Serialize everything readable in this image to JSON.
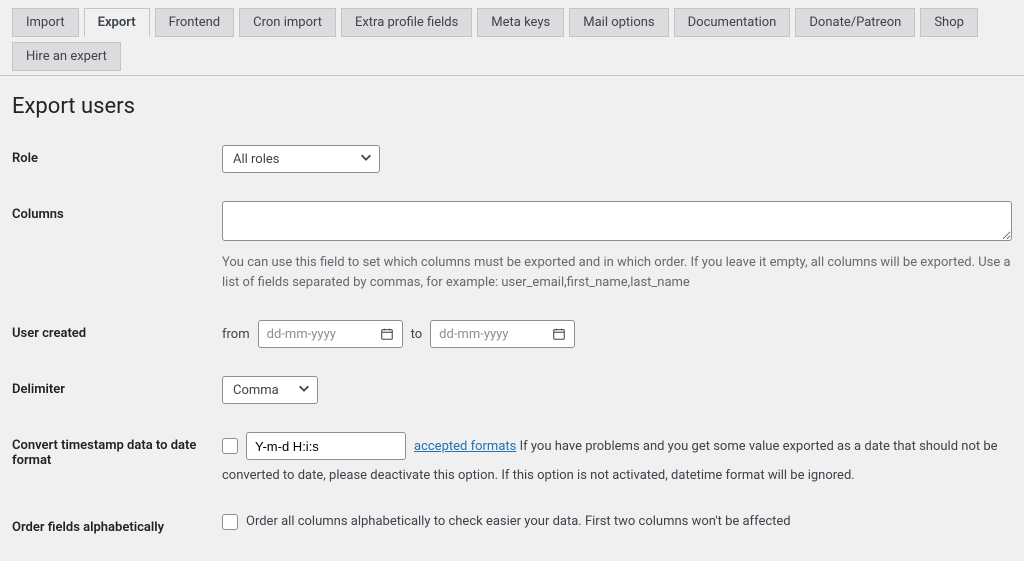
{
  "tabs": {
    "items": [
      {
        "label": "Import",
        "active": false
      },
      {
        "label": "Export",
        "active": true
      },
      {
        "label": "Frontend",
        "active": false
      },
      {
        "label": "Cron import",
        "active": false
      },
      {
        "label": "Extra profile fields",
        "active": false
      },
      {
        "label": "Meta keys",
        "active": false
      },
      {
        "label": "Mail options",
        "active": false
      },
      {
        "label": "Documentation",
        "active": false
      },
      {
        "label": "Donate/Patreon",
        "active": false
      },
      {
        "label": "Shop",
        "active": false
      },
      {
        "label": "Hire an expert",
        "active": false
      }
    ]
  },
  "page": {
    "title": "Export users"
  },
  "form": {
    "role": {
      "label": "Role",
      "selected": "All roles"
    },
    "columns": {
      "label": "Columns",
      "value": "",
      "help": "You can use this field to set which columns must be exported and in which order. If you leave it empty, all columns will be exported. Use a list of fields separated by commas, for example: user_email,first_name,last_name"
    },
    "user_created": {
      "label": "User created",
      "from_label": "from",
      "to_label": "to",
      "placeholder": "dd-mm-yyyy"
    },
    "delimiter": {
      "label": "Delimiter",
      "selected": "Comma"
    },
    "timestamp": {
      "label": "Convert timestamp data to date format",
      "format_value": "Y-m-d H:i:s",
      "link_text": "accepted formats",
      "suffix_inline": " If you have problems and you get some value exported as a date that should not be",
      "suffix_line2": "converted to date, please deactivate this option. If this option is not activated, datetime format will be ignored."
    },
    "alphabetical": {
      "label": "Order fields alphabetically",
      "desc": "Order all columns alphabetically to check easier your data. First two columns won't be affected"
    }
  }
}
